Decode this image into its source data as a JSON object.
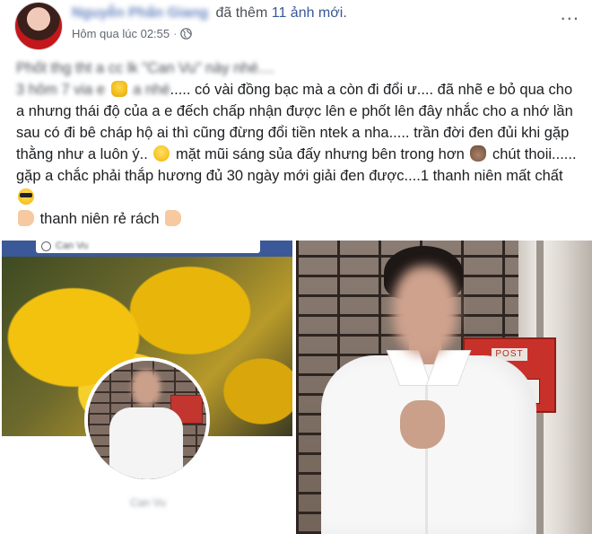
{
  "header": {
    "author_name": "Nguyễn Phấn Giang",
    "action_prefix": "đã thêm",
    "action_link": "11 ảnh mới",
    "action_suffix": ".",
    "timestamp": "Hôm qua lúc 02:55",
    "separator": "·",
    "privacy_icon": "globe-icon",
    "more_label": "..."
  },
  "post": {
    "line1_blurred": "Phốt thg tht a cc lk \"Can Vu\" này nhé....",
    "seg_blurred_start": "3 hôm 7 via e",
    "seg_blurred_mid": "a nhé",
    "seg1": "..... có vài đồng bạc mà a còn đi đổi ư.... đã nhẽ e bỏ qua cho a nhưng thái độ của a e đếch chấp nhận được lên e phốt lên đây nhắc cho a nhớ lần sau có đi bê cháp hộ ai thì cũng đừng đổi tiền ntek a nha..... trần đời đen đủi khi gặp thằng như a luôn ý..",
    "seg2": " mặt mũi sáng sủa đấy nhưng bên trong hơn",
    "seg3": " chút thoii...... gặp a chắc phải thắp hương đủ 30 ngày mới giải đen được....1 thanh niên mất chất",
    "seg4": " thanh niên rẻ rách",
    "emojis": [
      "pray-emoji",
      "laugh-emoji",
      "poop-emoji",
      "sunglasses-emoji",
      "victory-hand-emoji",
      "pointing-hand-emoji"
    ]
  },
  "photos": {
    "left": {
      "search_text": "Can Vu",
      "profile_caption": "Can Vu"
    },
    "right": {
      "mailbox_label": "POST"
    }
  },
  "colors": {
    "facebook_blue": "#3b5998",
    "link_blue": "#385898",
    "text": "#1c1e21",
    "meta_gray": "#616770"
  }
}
